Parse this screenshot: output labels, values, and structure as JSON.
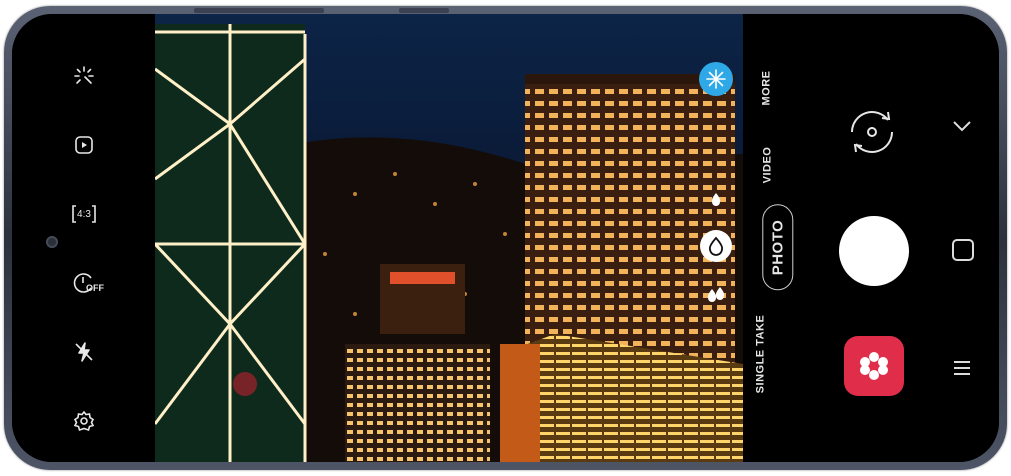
{
  "left_toolbar": {
    "icons": [
      "sparkle-icon",
      "motion-photo-icon",
      "aspect-ratio-icon",
      "timer-off-icon",
      "flash-off-icon",
      "settings-gear-icon"
    ],
    "aspect_ratio_label": "4:3",
    "timer_label": "OFF"
  },
  "modes": {
    "more": "MORE",
    "video": "VIDEO",
    "photo": "PHOTO",
    "single_take": "SINGLE TAKE"
  },
  "right_controls": {
    "icons": [
      "switch-camera-icon",
      "shutter-button",
      "gallery-thumbnail-icon",
      "chevron-down-icon",
      "square-home-icon",
      "menu-lines-icon"
    ]
  },
  "viewfinder": {
    "filter_icon": "snowflake-filter-icon",
    "effect_icons": [
      "water-drop-small-icon",
      "water-drop-selected-icon",
      "water-drops-icon"
    ]
  },
  "colors": {
    "gallery": "#e02d4a",
    "filter": "#2ea8e6",
    "sky": "#0a1a33"
  }
}
